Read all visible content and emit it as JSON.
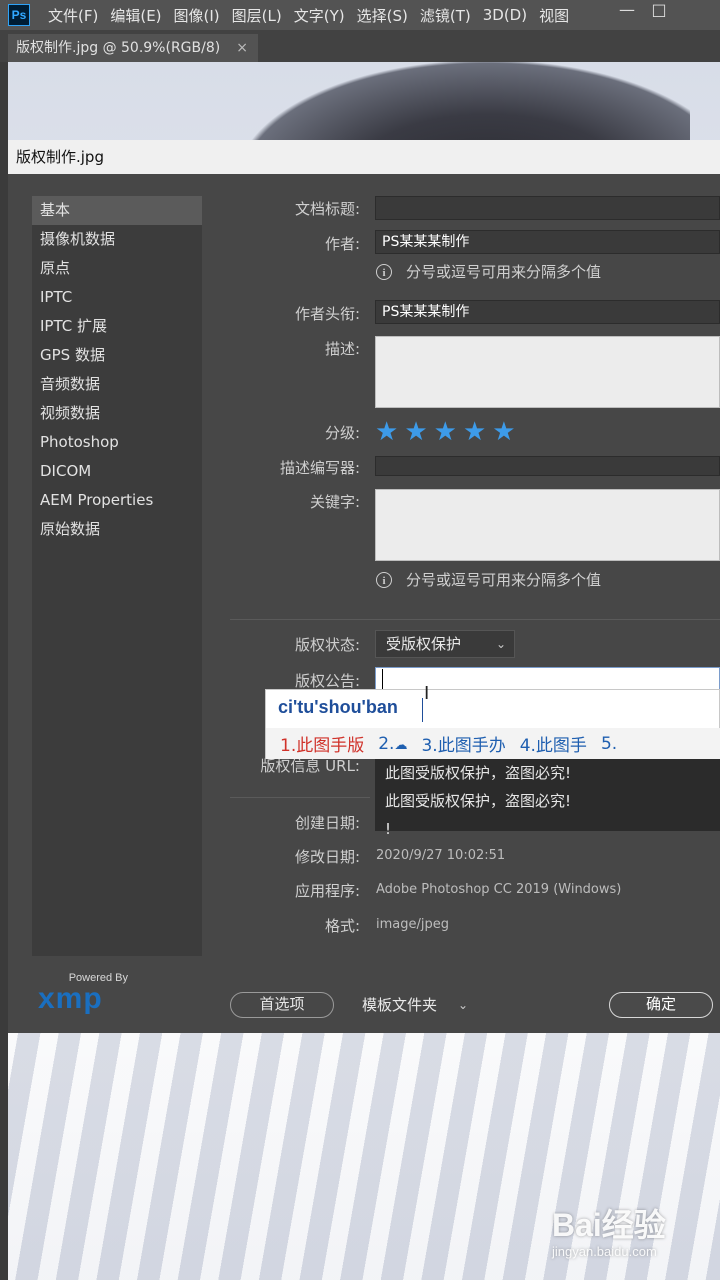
{
  "app": {
    "logo": "Ps",
    "menu": [
      "文件(F)",
      "编辑(E)",
      "图像(I)",
      "图层(L)",
      "文字(Y)",
      "选择(S)",
      "滤镜(T)",
      "3D(D)",
      "视图"
    ],
    "window_controls": {
      "minimize": "—",
      "restore": "□"
    }
  },
  "doc_tab": {
    "label": "版权制作.jpg @ 50.9%(RGB/8)",
    "close": "×"
  },
  "dialog": {
    "title": "版权制作.jpg",
    "sidebar": [
      "基本",
      "摄像机数据",
      "原点",
      "IPTC",
      "IPTC 扩展",
      "GPS 数据",
      "音频数据",
      "视频数据",
      "Photoshop",
      "DICOM",
      "AEM Properties",
      "原始数据"
    ],
    "fields": {
      "doc_title_label": "文档标题:",
      "author_label": "作者:",
      "author_value": "PS某某某制作",
      "author_hint": "分号或逗号可用来分隔多个值",
      "author_title_label": "作者头衔:",
      "author_title_value": "PS某某某制作",
      "description_label": "描述:",
      "rating_label": "分级:",
      "rating_value": 5,
      "desc_writer_label": "描述编写器:",
      "keywords_label": "关键字:",
      "keywords_hint": "分号或逗号可用来分隔多个值",
      "copyright_status_label": "版权状态:",
      "copyright_status_value": "受版权保护",
      "copyright_notice_label": "版权公告:",
      "copyright_url_label": "版权信息 URL:",
      "notice_lines": [
        "此图受版权保护，盗图必究!",
        "此图受版权保护，盗图必究!",
        "!"
      ],
      "created_label": "创建日期:",
      "modified_label": "修改日期:",
      "modified_value": "2020/9/27 10:02:51",
      "app_label": "应用程序:",
      "app_value": "Adobe Photoshop CC 2019 (Windows)",
      "format_label": "格式:",
      "format_value": "image/jpeg"
    },
    "info_icon": "i",
    "xmp": {
      "powered": "Powered By",
      "word": "xmp"
    },
    "buttons": {
      "prefs": "首选项",
      "template": "模板文件夹",
      "ok": "确定"
    }
  },
  "ime": {
    "pinyin": "ci'tu'shou'ban",
    "candidates": [
      "1.此图手版",
      "2.",
      "3.此图手办",
      "4.此图手",
      "5."
    ]
  },
  "watermark": {
    "main": "Bai经验",
    "sub": "jingyan.baidu.com"
  },
  "colors": {
    "accent": "#3d9be9",
    "ime_first": "#d0322a",
    "ime_text": "#1f5fb0"
  }
}
